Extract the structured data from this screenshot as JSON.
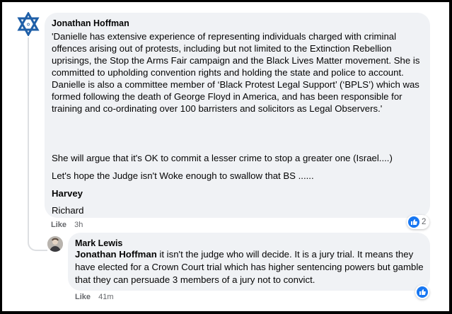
{
  "comment": {
    "author": "Jonathan Hoffman",
    "avatar_icon": "star-of-david-icon",
    "paragraph1": "'Danielle has extensive experience of representing individuals charged with criminal offences arising out of protests, including but not limited to the Extinction Rebellion uprisings, the Stop the Arms Fair campaign and the Black Lives Matter movement. She is committed to upholding convention rights and holding the state and police to account.",
    "paragraph1b": "Danielle is also a committee member of ‘Black Protest Legal Support’ (‘BPLS’) which was formed following the death of George Floyd in America, and has been responsible for training and co-ordinating over 100 barristers and solicitors as Legal Observers.'",
    "paragraph2": "She will argue that it's OK to commit a lesser crime to stop a greater one (Israel....)",
    "paragraph3": "Let's hope the Judge isn't Woke enough to swallow that BS ......",
    "paragraph4": "Harvey",
    "paragraph5": "Richard",
    "like_label": "Like",
    "time": "3h",
    "reaction_count": "2",
    "accent_color": "#1877f2"
  },
  "reply": {
    "author": "Mark Lewis",
    "mention": "Jonathan Hoffman",
    "text": " it isn't the judge who will decide. It is a jury trial. It means they have elected for a Crown Court trial which has higher sentencing powers but gamble that they can persuade 3 members of a jury not to convict.",
    "like_label": "Like",
    "time": "41m"
  }
}
